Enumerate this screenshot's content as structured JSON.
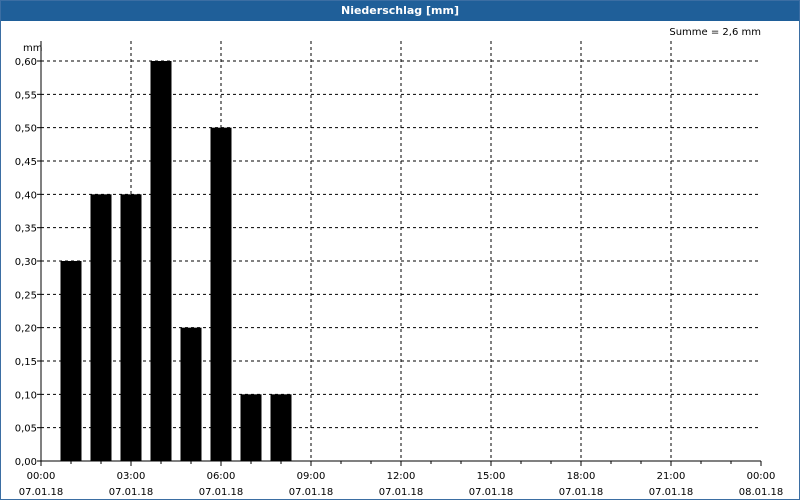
{
  "window": {
    "title": "Niederschlag [mm]"
  },
  "summary": "Summe = 2,6 mm",
  "chart_data": {
    "type": "bar",
    "title": "Niederschlag [mm]",
    "ylabel": "mm",
    "ylim": [
      0,
      0.6
    ],
    "yticks": [
      "0,00",
      "0,05",
      "0,10",
      "0,15",
      "0,20",
      "0,25",
      "0,30",
      "0,35",
      "0,40",
      "0,45",
      "0,50",
      "0,55",
      "0,60"
    ],
    "xticks": [
      {
        "time": "00:00",
        "date": "07.01.18"
      },
      {
        "time": "03:00",
        "date": "07.01.18"
      },
      {
        "time": "06:00",
        "date": "07.01.18"
      },
      {
        "time": "09:00",
        "date": "07.01.18"
      },
      {
        "time": "12:00",
        "date": "07.01.18"
      },
      {
        "time": "15:00",
        "date": "07.01.18"
      },
      {
        "time": "18:00",
        "date": "07.01.18"
      },
      {
        "time": "21:00",
        "date": "07.01.18"
      },
      {
        "time": "00:00",
        "date": "08.01.18"
      }
    ],
    "xrange_hours": [
      0,
      24
    ],
    "bars": [
      {
        "hour": 1,
        "value": 0.3
      },
      {
        "hour": 2,
        "value": 0.4
      },
      {
        "hour": 3,
        "value": 0.4
      },
      {
        "hour": 4,
        "value": 0.6
      },
      {
        "hour": 5,
        "value": 0.2
      },
      {
        "hour": 6,
        "value": 0.5
      },
      {
        "hour": 7,
        "value": 0.1
      },
      {
        "hour": 8,
        "value": 0.1
      }
    ],
    "bar_color": "#000000",
    "grid": true
  }
}
